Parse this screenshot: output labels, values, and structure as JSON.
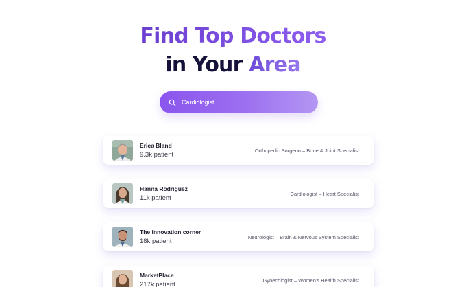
{
  "hero": {
    "title_part1": "Find Top Doctors",
    "title_part2_prefix": "in Your ",
    "title_part2_accent": "Area"
  },
  "search": {
    "value": "Cardiologist",
    "icon": "search-icon"
  },
  "doctors": [
    {
      "name": "Erica Bland",
      "patients": "9.3k patient",
      "specialty": "Orthopedic Surgeon – Bone & Joint Specialist"
    },
    {
      "name": "Hanna Rodriguez",
      "patients": "11k patient",
      "specialty": "Cardiologist – Heart Specialist"
    },
    {
      "name": "The innovation corner",
      "patients": "18k patient",
      "specialty": "Neurologist – Brain & Nervous System Specialist"
    },
    {
      "name": "MarketPlace",
      "patients": "217k patient",
      "specialty": "Gynecologist – Women's Health Specialist"
    }
  ],
  "colors": {
    "accent": "#7b45e0",
    "title_dark": "#15123a",
    "search_gradient_start": "#8a55ee",
    "search_gradient_end": "#b497f3"
  }
}
